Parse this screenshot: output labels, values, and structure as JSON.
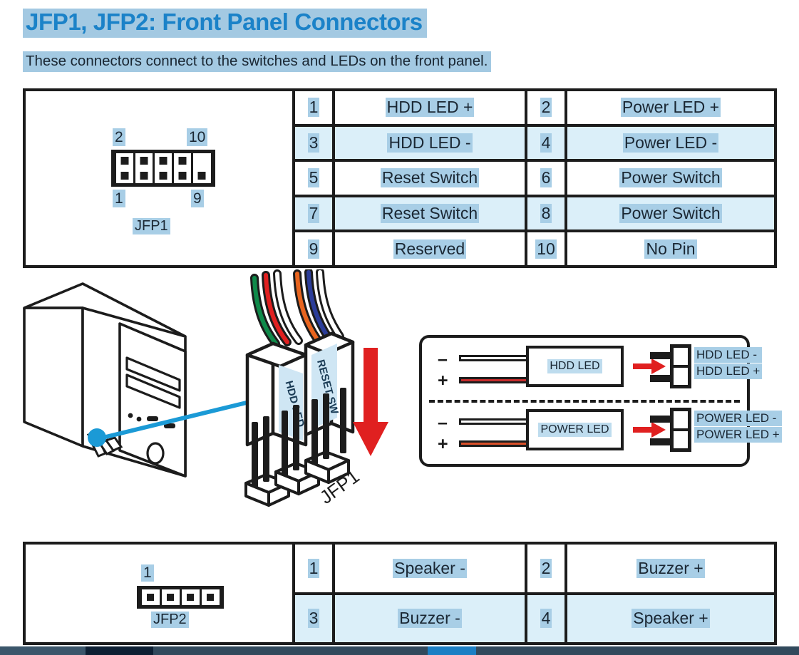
{
  "page": {
    "title": "JFP1, JFP2: Front Panel Connectors",
    "subtitle": "These connectors connect to the switches and LEDs on the front panel."
  },
  "colors": {
    "title_text": "#1b82c8",
    "highlight": "#a3c9e2",
    "cell_highlight": "#a8cee6",
    "alt_row": "#dbeff9",
    "outline": "#1c1c1c",
    "arrow_red": "#e02020",
    "hdd_wire_red": "#c62b2b",
    "power_wire_orange": "#d9502a",
    "callout_blue": "#1b9ad6"
  },
  "jfp1": {
    "connector": {
      "name": "JFP1",
      "label_top_left": "2",
      "label_top_right": "10",
      "label_bottom_left": "1",
      "label_bottom_right": "9",
      "slots": 5,
      "missing_top_pin_slot": 5
    },
    "rows": [
      {
        "odd_pin": "1",
        "odd_signal": "HDD LED +",
        "even_pin": "2",
        "even_signal": "Power LED +",
        "alt": false
      },
      {
        "odd_pin": "3",
        "odd_signal": "HDD LED -",
        "even_pin": "4",
        "even_signal": "Power LED -",
        "alt": true
      },
      {
        "odd_pin": "5",
        "odd_signal": "Reset Switch",
        "even_pin": "6",
        "even_signal": "Power Switch",
        "alt": false
      },
      {
        "odd_pin": "7",
        "odd_signal": "Reset Switch",
        "even_pin": "8",
        "even_signal": "Power Switch",
        "alt": true
      },
      {
        "odd_pin": "9",
        "odd_signal": "Reserved",
        "even_pin": "10",
        "even_signal": "No Pin",
        "alt": false
      }
    ]
  },
  "jfp2": {
    "connector": {
      "name": "JFP2",
      "label_pin1": "1",
      "slots": 4
    },
    "rows": [
      {
        "odd_pin": "1",
        "odd_signal": "Speaker -",
        "even_pin": "2",
        "even_signal": "Buzzer +",
        "alt": false
      },
      {
        "odd_pin": "3",
        "odd_signal": "Buzzer -",
        "even_pin": "4",
        "even_signal": "Speaker +",
        "alt": true
      }
    ]
  },
  "illustration": {
    "cable_labels": {
      "left": "HDD LED",
      "right": "RESET SW"
    },
    "header_label": "JFP1"
  },
  "led_panel": {
    "rows": [
      {
        "minus": "–",
        "plus": "+",
        "device": "HDD LED",
        "terminal_top": "HDD LED -",
        "terminal_bottom": "HDD LED +",
        "pos_wire_color": "#c62b2b"
      },
      {
        "minus": "–",
        "plus": "+",
        "device": "POWER LED",
        "terminal_top": "POWER LED -",
        "terminal_bottom": "POWER LED +",
        "pos_wire_color": "#d9502a"
      }
    ]
  }
}
